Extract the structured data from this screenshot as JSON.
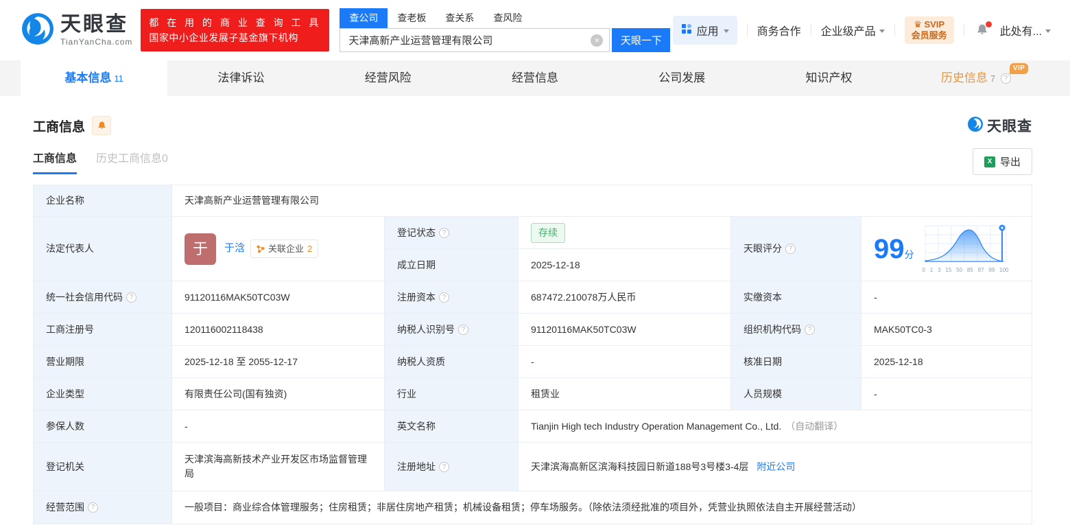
{
  "brand": {
    "name": "天眼查",
    "domain": "TianYanCha.com",
    "slogan_line1": "都 在 用 的 商 业 查 询 工 具",
    "slogan_line2": "国家中小企业发展子基金旗下机构"
  },
  "search": {
    "tabs": [
      {
        "label": "查公司"
      },
      {
        "label": "查老板"
      },
      {
        "label": "查关系"
      },
      {
        "label": "查风险"
      }
    ],
    "value": "天津高新产业运营管理有限公司",
    "button": "天眼一下"
  },
  "nav": {
    "apps": "应用",
    "biz": "商务合作",
    "enterprise": "企业级产品",
    "vip_line1": "SVIP",
    "vip_line2": "会员服务",
    "user": "此处有..."
  },
  "tabs": [
    {
      "label": "基本信息",
      "count": "11"
    },
    {
      "label": "法律诉讼"
    },
    {
      "label": "经营风险"
    },
    {
      "label": "经营信息"
    },
    {
      "label": "公司发展"
    },
    {
      "label": "知识产权"
    },
    {
      "label": "历史信息",
      "count": "7",
      "vip": "VIP"
    }
  ],
  "section": {
    "title": "工商信息",
    "subtab_active": "工商信息",
    "subtab_history": "历史工商信息0",
    "export": "导出",
    "watermark": "天眼查"
  },
  "table": {
    "company_name": {
      "label": "企业名称",
      "value": "天津高新产业运营管理有限公司"
    },
    "legal_rep": {
      "label": "法定代表人",
      "avatar": "于",
      "name": "于浛",
      "related_label": "关联企业",
      "related_count": "2"
    },
    "reg_status": {
      "label": "登记状态",
      "value": "存续"
    },
    "est_date": {
      "label": "成立日期",
      "value": "2025-12-18"
    },
    "score": {
      "label": "天眼评分",
      "value": "99",
      "unit": "分",
      "axis": [
        "0",
        "1",
        "3",
        "15",
        "50",
        "85",
        "97",
        "99",
        "100"
      ]
    },
    "credit_code": {
      "label": "统一社会信用代码",
      "value": "91120116MAK50TC03W"
    },
    "reg_capital": {
      "label": "注册资本",
      "value": "687472.210078万人民币"
    },
    "paid_capital": {
      "label": "实缴资本",
      "value": "-"
    },
    "reg_number": {
      "label": "工商注册号",
      "value": "120116002118438"
    },
    "taxpayer_id": {
      "label": "纳税人识别号",
      "value": "91120116MAK50TC03W"
    },
    "org_code": {
      "label": "组织机构代码",
      "value": "MAK50TC0-3"
    },
    "biz_term": {
      "label": "营业期限",
      "value": "2025-12-18 至 2055-12-17"
    },
    "taxpayer_qual": {
      "label": "纳税人资质",
      "value": "-"
    },
    "approval_date": {
      "label": "核准日期",
      "value": "2025-12-18"
    },
    "company_type": {
      "label": "企业类型",
      "value": "有限责任公司(国有独资)"
    },
    "industry": {
      "label": "行业",
      "value": "租赁业"
    },
    "staff_size": {
      "label": "人员规模",
      "value": "-"
    },
    "insured_count": {
      "label": "参保人数",
      "value": "-"
    },
    "english_name": {
      "label": "英文名称",
      "value": "Tianjin High tech Industry Operation Management Co., Ltd.",
      "note": "（自动翻译）"
    },
    "reg_authority": {
      "label": "登记机关",
      "value": "天津滨海高新技术产业开发区市场监督管理局"
    },
    "reg_address": {
      "label": "注册地址",
      "value": "天津滨海高新区滨海科技园日新道188号3号楼3-4层",
      "link": "附近公司"
    },
    "biz_scope": {
      "label": "经营范围",
      "value": "一般项目：商业综合体管理服务；住房租赁；非居住房地产租赁；机械设备租赁；停车场服务。（除依法须经批准的项目外，凭营业执照依法自主开展经营活动）"
    }
  }
}
